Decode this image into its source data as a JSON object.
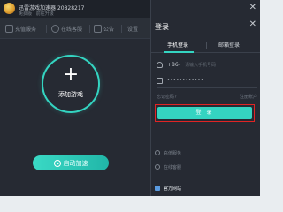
{
  "app": {
    "title": "迅雷游戏加速器",
    "user_id": "20828217",
    "subtitle": "免费版 · 前往升级",
    "toolbar": {
      "items": [
        {
          "label": "充值服务",
          "icon": "card-icon"
        },
        {
          "label": "在线客服",
          "icon": "headset-icon"
        },
        {
          "label": "公告",
          "icon": "notice-icon"
        },
        {
          "label": "设置",
          "icon": "settings-icon"
        }
      ]
    },
    "add_game_label": "添加游戏",
    "add_game_symbol": "+",
    "start_label": "启动加速"
  },
  "login": {
    "title": "登录",
    "close_symbol": "✕",
    "window_close_symbol": "✕",
    "tabs": [
      {
        "label": "手机登录",
        "active": true
      },
      {
        "label": "邮箱登录",
        "active": false
      }
    ],
    "phone": {
      "country_code": "+86",
      "caret": "⌄",
      "placeholder": "请输入手机号码"
    },
    "password": {
      "masked": "••••••••••••"
    },
    "forgot_password": "忘记密码?",
    "register": "注册账户",
    "submit_label": "登 录",
    "side_links": [
      {
        "label": "充值服务",
        "icon": "card-icon"
      },
      {
        "label": "在线客服",
        "icon": "headset-icon"
      },
      {
        "label": "官方网站",
        "icon": "globe-icon"
      }
    ]
  },
  "colors": {
    "accent": "#34d4c1",
    "background": "#262a33",
    "highlight_border": "#e02424"
  }
}
